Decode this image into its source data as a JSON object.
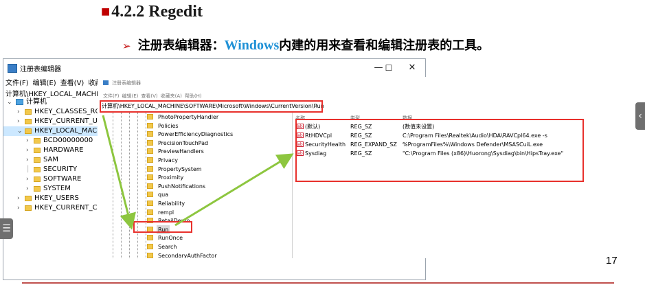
{
  "slide": {
    "heading_marker": "■",
    "heading": "4.2.2 Regedit",
    "subtitle_arrow": "➢",
    "subtitle_prefix": "注册表编辑器：",
    "subtitle_windows": "Windows",
    "subtitle_suffix": "内建的用来查看和编辑注册表的工具。",
    "page_number": "17",
    "side_tab_glyph": "‹",
    "menu_glyph": "☰",
    "accent_color": "#c00000",
    "windows_color": "#1e90d6",
    "highlight_color": "#e8302c",
    "arrow_color": "#8dc63f"
  },
  "window": {
    "title": "注册表编辑器",
    "menu": [
      "文件(F)",
      "编辑(E)",
      "查看(V)",
      "收藏夹"
    ],
    "address": "计算机\\HKEY_LOCAL_MACHI",
    "minimize": "—",
    "maximize": "☐",
    "close": "✕",
    "tree": {
      "root": "计算机",
      "hives": [
        "HKEY_CLASSES_ROO",
        "HKEY_CURRENT_US",
        "HKEY_LOCAL_MACH",
        "HKEY_USERS",
        "HKEY_CURRENT_CC"
      ],
      "hklm_children": [
        "BCD00000000",
        "HARDWARE",
        "SAM",
        "SECURITY",
        "SOFTWARE",
        "SYSTEM"
      ]
    }
  },
  "zoom": {
    "title": "注册表编辑器",
    "menu": [
      "文件(F)",
      "编辑(E)",
      "查看(V)",
      "收藏夹(A)",
      "帮助(H)"
    ],
    "address": "计算机\\HKEY_LOCAL_MACHINE\\SOFTWARE\\Microsoft\\Windows\\CurrentVersion\\Run",
    "tree_items": [
      "PhotoPropertyHandler",
      "Policies",
      "PowerEfficiencyDiagnostics",
      "PrecisionTouchPad",
      "PreviewHandlers",
      "Privacy",
      "PropertySystem",
      "Proximity",
      "PushNotifications",
      "qua",
      "Reliability",
      "rempl",
      "RetailDemo",
      "Run",
      "RunOnce",
      "Search",
      "SecondaryAuthFactor"
    ],
    "selected_item": "Run",
    "columns": [
      "名称",
      "类型",
      "数据"
    ],
    "values": [
      {
        "name": "(默认)",
        "type": "REG_SZ",
        "data": "(数值未设置)"
      },
      {
        "name": "RtHDVCpl",
        "type": "REG_SZ",
        "data": "C:\\Program Files\\Realtek\\Audio\\HDA\\RAVCpl64.exe -s"
      },
      {
        "name": "SecurityHealth",
        "type": "REG_EXPAND_SZ",
        "data": "%ProgramFiles%\\Windows Defender\\MSASCuiL.exe"
      },
      {
        "name": "Sysdiag",
        "type": "REG_SZ",
        "data": "\"C:\\Program Files (x86)\\Huorong\\Sysdiag\\bin\\HipsTray.exe\""
      }
    ]
  }
}
